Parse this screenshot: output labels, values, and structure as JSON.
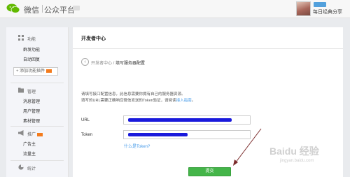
{
  "header": {
    "logo_text": "微信",
    "logo_sub": "公众平台",
    "user_name": "每日经典分享"
  },
  "sidebar": {
    "sections": [
      {
        "label": "功能",
        "icon": "grid-icon",
        "items": [
          "群发功能",
          "自动回复"
        ]
      },
      {
        "label": "管理",
        "icon": "folder-icon",
        "items": [
          "消息管理",
          "用户管理",
          "素材管理"
        ]
      },
      {
        "label": "推广",
        "icon": "megaphone-icon",
        "items": [
          "广告主",
          "流量主"
        ]
      },
      {
        "label": "统计",
        "icon": "chart-icon",
        "items": []
      }
    ],
    "add_plugin_label": "+ 添加功能插件"
  },
  "main": {
    "title": "开发者中心",
    "breadcrumb_parent": "开发者中心",
    "breadcrumb_sep": " / ",
    "breadcrumb_current": "填写服务器配置",
    "desc_line1": "请填写接口配置信息，此信息需要你拥有自己的服务器资源。",
    "desc_line2": "填写的URL需要正确响应微信发送的Token验证，请阅读",
    "desc_link": "接入指南",
    "desc_end": "。",
    "url_label": "URL",
    "token_label": "Token",
    "help_link": "什么是Token?",
    "submit_label": "提交"
  },
  "colors": {
    "accent_green": "#44b549",
    "link_blue": "#459ae9",
    "redaction": "#1a1adc"
  }
}
